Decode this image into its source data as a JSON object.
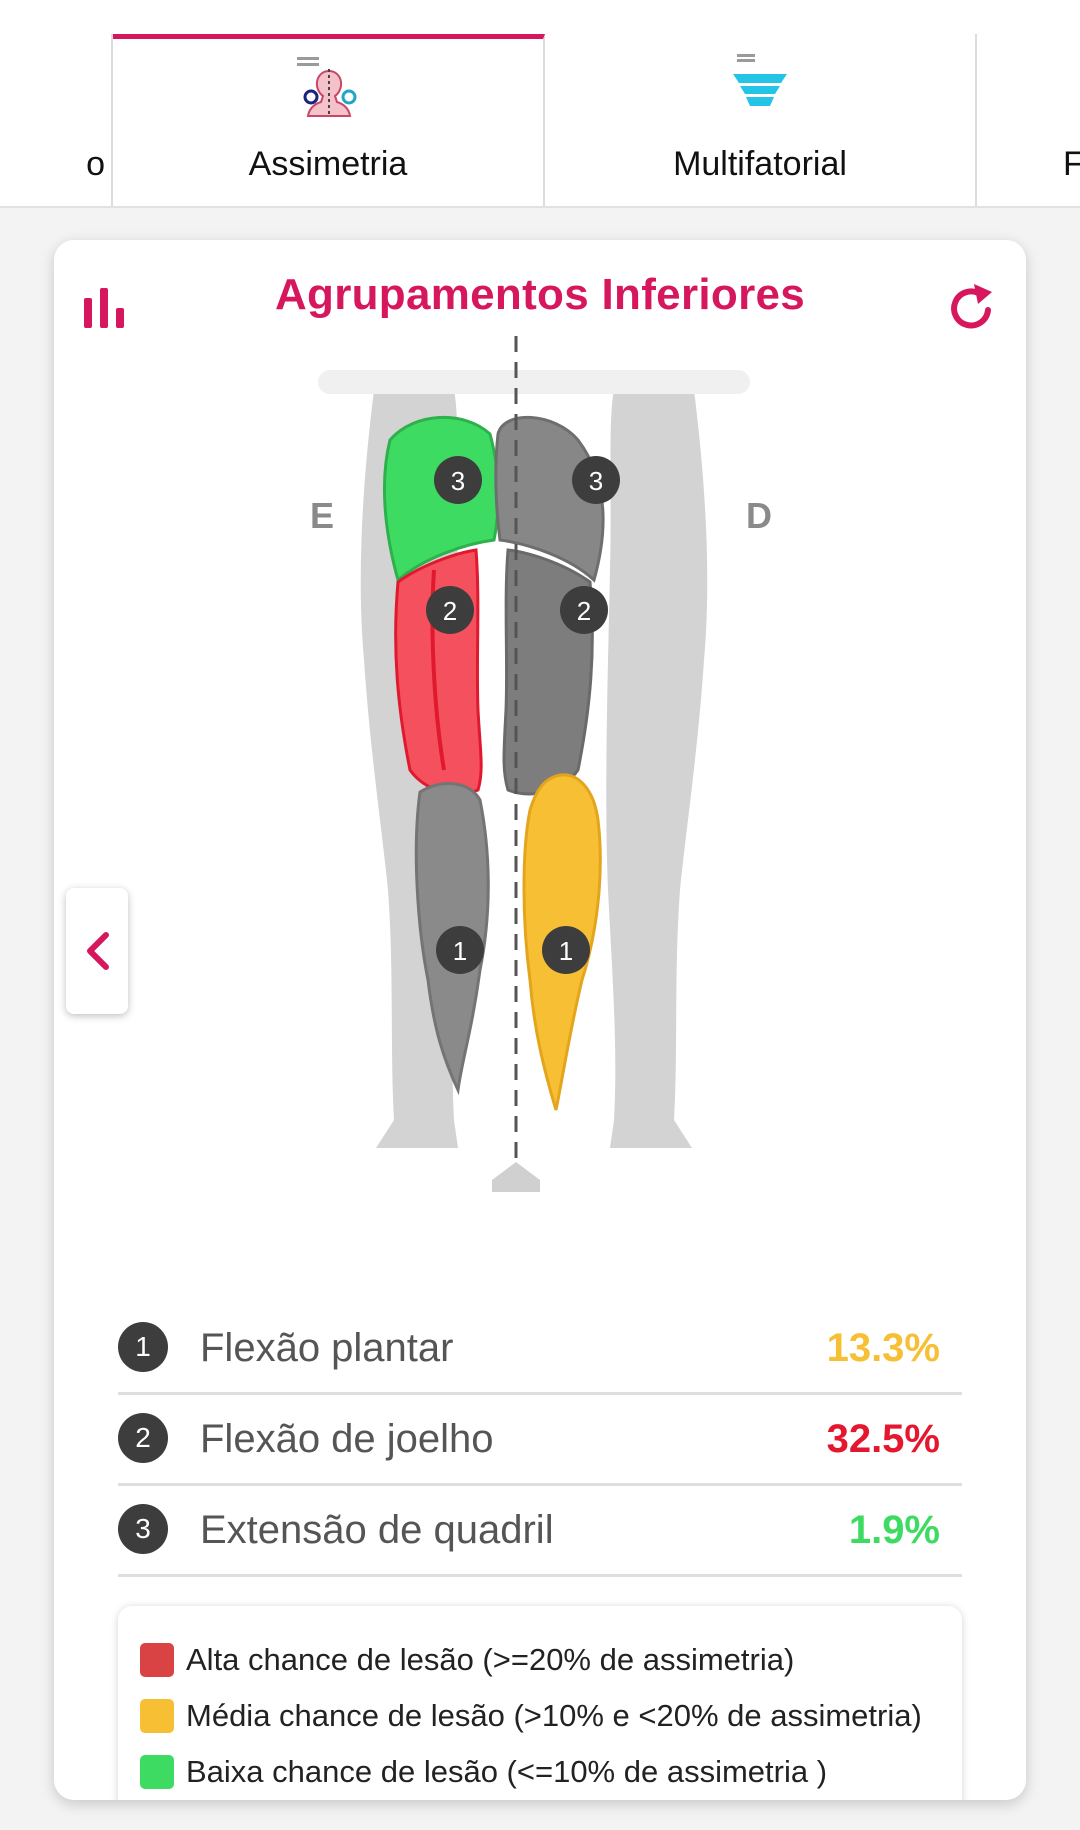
{
  "tabs": [
    {
      "label": "o"
    },
    {
      "label": "Assimetria",
      "active": true,
      "icon": "body-symmetry-icon"
    },
    {
      "label": "Multifatorial",
      "icon": "funnel-icon"
    },
    {
      "label": "F"
    }
  ],
  "card": {
    "title": "Agrupamentos  Inferiores",
    "left_side": "E",
    "right_side": "D",
    "markers": [
      "1",
      "2",
      "3"
    ]
  },
  "results": [
    {
      "num": "1",
      "name": "Flexão plantar",
      "value": "13.3%",
      "color": "#f6bf34",
      "side": "D"
    },
    {
      "num": "2",
      "name": "Flexão de joelho",
      "value": "32.5%",
      "color": "#e5172f",
      "side": "E"
    },
    {
      "num": "3",
      "name": "Extensão de quadril",
      "value": "1.9%",
      "color": "#3ddb62",
      "side": "E"
    }
  ],
  "legend": [
    {
      "text": "Alta chance de lesão (>=20% de assimetria)",
      "color": "#d94343"
    },
    {
      "text": "Média chance de lesão (>10% e <20% de assimetria)",
      "color": "#f6bf34"
    },
    {
      "text": "Baixa chance de lesão (<=10% de assimetria )",
      "color": "#3ddb62"
    }
  ],
  "colors": {
    "accent": "#d6175e",
    "muscle_default": "#888888"
  }
}
